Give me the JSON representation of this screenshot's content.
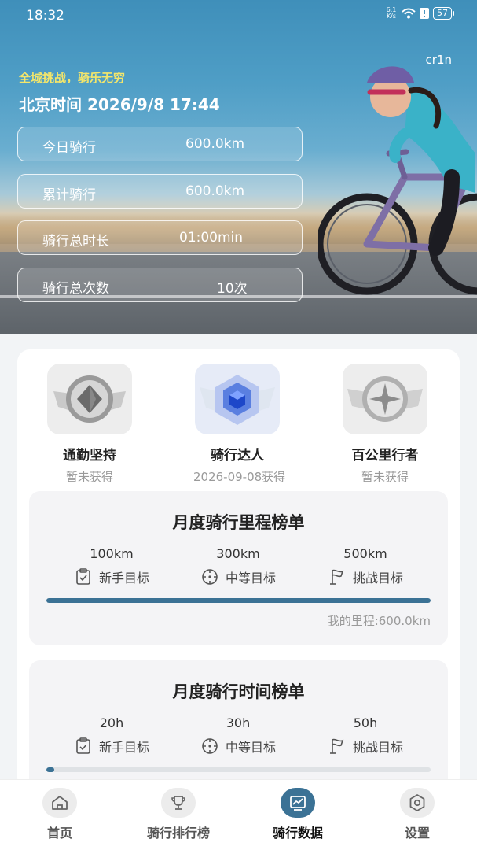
{
  "status_bar": {
    "time": "18:32",
    "net_speed_top": "6.1",
    "net_speed_bottom": "K/s",
    "battery": "57"
  },
  "hero": {
    "user": "cr1n",
    "slogan": "全城挑战，骑乐无穷",
    "beijing_time": "北京时间 2026/9/8 17:44",
    "stats": [
      {
        "label": "今日骑行",
        "value": "600.0km"
      },
      {
        "label": "累计骑行",
        "value": "600.0km"
      },
      {
        "label": "骑行总时长",
        "value": "01:00min"
      },
      {
        "label": "骑行总次数",
        "value": "10次"
      }
    ]
  },
  "badges": [
    {
      "name": "通勤坚持",
      "status": "暂未获得",
      "icon": "silver-diamond-badge-icon"
    },
    {
      "name": "骑行达人",
      "status": "2026-09-08获得",
      "icon": "blue-cube-badge-icon"
    },
    {
      "name": "百公里行者",
      "status": "暂未获得",
      "icon": "silver-star-badge-icon"
    }
  ],
  "distance_rank": {
    "title": "月度骑行里程榜单",
    "goals": [
      {
        "amount": "100km",
        "label": "新手目标",
        "icon": "clipboard-check-icon"
      },
      {
        "amount": "300km",
        "label": "中等目标",
        "icon": "crosshair-icon"
      },
      {
        "amount": "500km",
        "label": "挑战目标",
        "icon": "flag-icon"
      }
    ],
    "progress_percent": 100,
    "mine": "我的里程:600.0km"
  },
  "time_rank": {
    "title": "月度骑行时间榜单",
    "goals": [
      {
        "amount": "20h",
        "label": "新手目标",
        "icon": "clipboard-check-icon"
      },
      {
        "amount": "30h",
        "label": "中等目标",
        "icon": "crosshair-icon"
      },
      {
        "amount": "50h",
        "label": "挑战目标",
        "icon": "flag-icon"
      }
    ],
    "progress_percent": 2
  },
  "tabs": [
    {
      "label": "首页",
      "icon": "home-icon"
    },
    {
      "label": "骑行排行榜",
      "icon": "trophy-icon"
    },
    {
      "label": "骑行数据",
      "icon": "chart-icon",
      "active": true
    },
    {
      "label": "设置",
      "icon": "settings-icon"
    }
  ],
  "colors": {
    "accent": "#3b7295",
    "slogan": "#f3e66b"
  }
}
